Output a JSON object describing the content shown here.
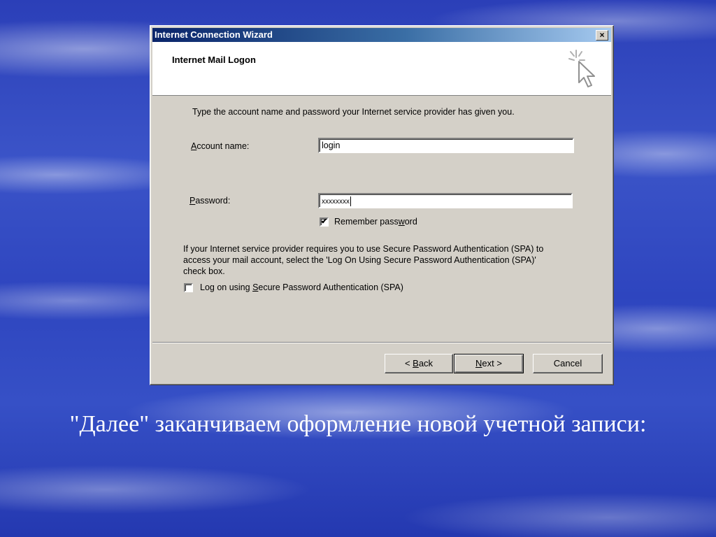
{
  "window": {
    "title": "Internet Connection Wizard",
    "close_glyph": "×",
    "header_title": "Internet Mail Logon",
    "header_icon": "wizard-cursor-icon"
  },
  "form": {
    "instruction": "Type the account name and password your Internet service provider has given you.",
    "account_label_pre": "",
    "account_label_key": "A",
    "account_label_post": "ccount name:",
    "account_value": "login",
    "password_label_pre": "",
    "password_label_key": "P",
    "password_label_post": "assword:",
    "password_value": "xxxxxxxx",
    "remember_label_pre": "Remember pass",
    "remember_label_key": "w",
    "remember_label_post": "ord",
    "remember_checked": "✔",
    "spa_info": "If your Internet service provider requires you to use Secure Password Authentication (SPA) to access your mail account, select the 'Log On Using Secure Password Authentication (SPA)' check box.",
    "spa_label_pre": "Log on using ",
    "spa_label_key": "S",
    "spa_label_post": "ecure Password Authentication (SPA)",
    "spa_checked": ""
  },
  "buttons": {
    "back_pre": "< ",
    "back_key": "B",
    "back_post": "ack",
    "next_pre": "",
    "next_key": "N",
    "next_post": "ext >",
    "cancel": "Cancel"
  },
  "slide": {
    "caption": "\"Далее\" заканчиваем оформление новой учетной записи:"
  },
  "colors": {
    "titlebar_start": "#0a246a",
    "dialog_face": "#d4d0c8",
    "background_blue": "#2e45bf"
  }
}
